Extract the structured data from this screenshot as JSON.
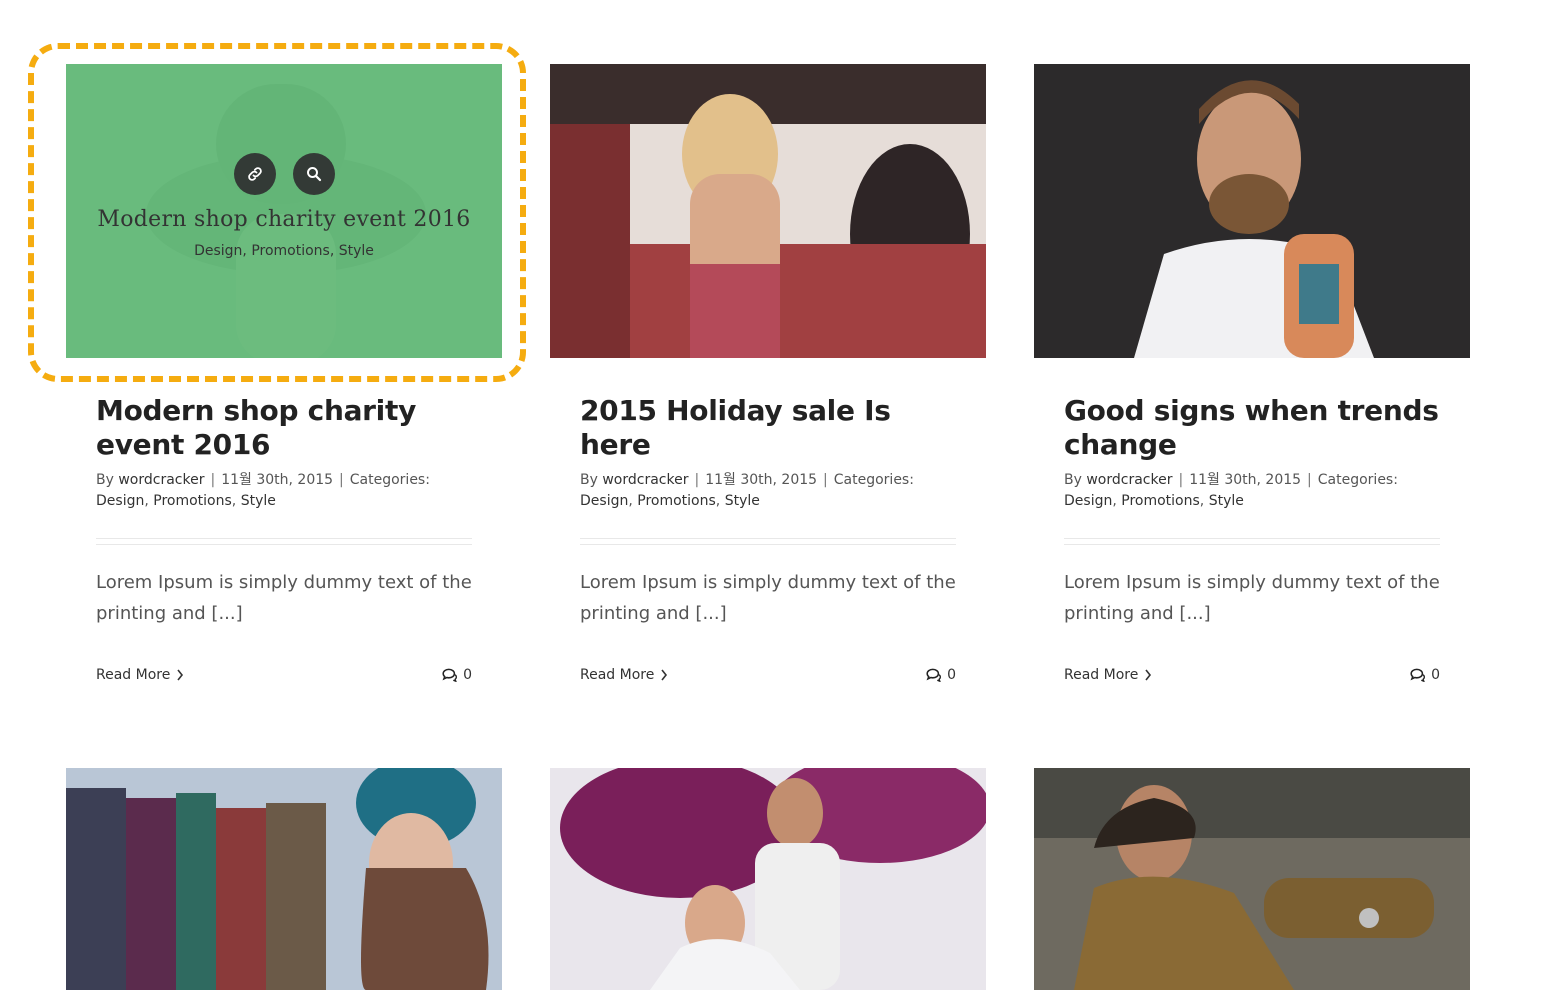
{
  "posts": [
    {
      "title": "Modern shop charity event 2016",
      "overlay_title": "Modern shop charity event 2016",
      "overlay_categories": "Design, Promotions, Style",
      "by_label": "By",
      "author": "wordcracker",
      "date": "11월 30th, 2015",
      "categories_label": "Categories:",
      "categories": [
        "Design",
        "Promotions",
        "Style"
      ],
      "excerpt": "Lorem Ipsum is simply dummy text of the printing and [...]",
      "read_more": "Read More",
      "comment_count": "0"
    },
    {
      "title": "2015 Holiday sale Is here",
      "by_label": "By",
      "author": "wordcracker",
      "date": "11월 30th, 2015",
      "categories_label": "Categories:",
      "categories": [
        "Design",
        "Promotions",
        "Style"
      ],
      "excerpt": "Lorem Ipsum is simply dummy text of the printing and [...]",
      "read_more": "Read More",
      "comment_count": "0"
    },
    {
      "title": "Good signs when trends change",
      "by_label": "By",
      "author": "wordcracker",
      "date": "11월 30th, 2015",
      "categories_label": "Categories:",
      "categories": [
        "Design",
        "Promotions",
        "Style"
      ],
      "excerpt": "Lorem Ipsum is simply dummy text of the printing and [...]",
      "read_more": "Read More",
      "comment_count": "0"
    }
  ],
  "colors": {
    "overlay": "#65bc7b",
    "highlight": "#f5ac10",
    "icon_circle": "#333a36"
  },
  "icons": [
    "link-icon",
    "search-icon",
    "chevron-right-icon",
    "comments-icon"
  ]
}
